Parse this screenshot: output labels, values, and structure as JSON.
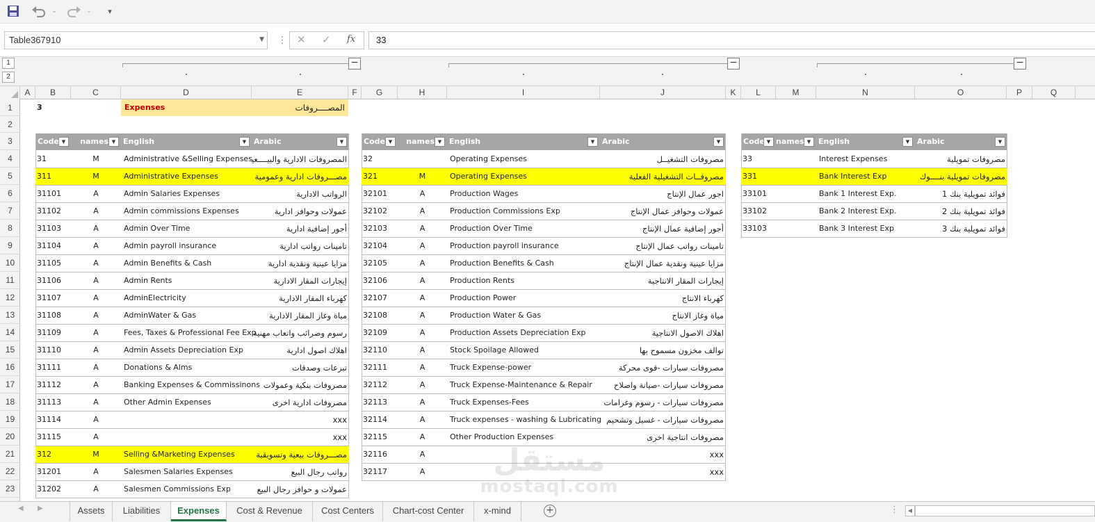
{
  "toolbar": {
    "save_icon": "save-icon",
    "undo_icon": "undo-icon",
    "redo_icon": "redo-icon",
    "customize_icon": "customize-icon"
  },
  "formula_bar": {
    "name_box": "Table367910",
    "cancel": "✕",
    "enter": "✓",
    "fx": "fx",
    "formula": "33"
  },
  "outline_levels": [
    "1",
    "2"
  ],
  "columns": [
    "A",
    "B",
    "C",
    "D",
    "E",
    "F",
    "G",
    "H",
    "I",
    "J",
    "K",
    "L",
    "M",
    "N",
    "O",
    "P",
    "Q"
  ],
  "rows": [
    "1",
    "2",
    "3",
    "4",
    "5",
    "6",
    "7",
    "8",
    "9",
    "10",
    "11",
    "12",
    "13",
    "14",
    "15",
    "16",
    "17",
    "18",
    "19",
    "20",
    "21",
    "22",
    "23"
  ],
  "row1": {
    "b": "3",
    "d": "Expenses",
    "e": "المصــــروفات"
  },
  "table1": {
    "headers": [
      "Code",
      "names",
      "English",
      "Arabic"
    ],
    "rows": [
      [
        "31",
        "M",
        "Administrative &Selling Expenses",
        "المصروفات الادارية والبيــــعية"
      ],
      [
        "311",
        "M",
        "Administrative Expenses",
        "مصـــروفات ادارية وعمومية"
      ],
      [
        "31101",
        "A",
        "Admin Salaries Expenses",
        "الرواتب الادارية"
      ],
      [
        "31102",
        "A",
        "Admin commissions Expenses",
        "عمولات وحوافز ادارية"
      ],
      [
        "31103",
        "A",
        "Admin Over Time",
        "أجور إضافية ادارية"
      ],
      [
        "31104",
        "A",
        "Admin payroll insurance",
        "تامينات رواتب ادارية"
      ],
      [
        "31105",
        "A",
        "Admin Benefits & Cash",
        "مزايا عينية ونقدية ادارية"
      ],
      [
        "31106",
        "A",
        "Admin Rents",
        "إيجارات المقار الادارية"
      ],
      [
        "31107",
        "A",
        "AdminElectricity",
        "كهرباء المقار الادارية"
      ],
      [
        "31108",
        "A",
        "AdminWater & Gas",
        "مياة وغاز المقار الادارية"
      ],
      [
        "31109",
        "A",
        "Fees, Taxes & Professional Fee Exp",
        "رسوم وضرائب واتعاب مهنية"
      ],
      [
        "31110",
        "A",
        "Admin Assets Depreciation Exp",
        "اهلاك اصول ادارية"
      ],
      [
        "31111",
        "A",
        "Donations & Alms",
        "تبرعات وصدقات"
      ],
      [
        "31112",
        "A",
        "Banking Expenses & Commissinons",
        "مصروفات بنكية وعمولات"
      ],
      [
        "31113",
        "A",
        "Other Admin Expenses",
        "مصروفات ادارية اخرى"
      ],
      [
        "31114",
        "A",
        "",
        "xxx"
      ],
      [
        "31115",
        "A",
        "",
        "xxx"
      ],
      [
        "312",
        "M",
        "Selling &Marketing Expenses",
        "مصـــروفات بيعية وتسويقية"
      ],
      [
        "31201",
        "A",
        "Salesmen Salaries Expenses",
        "رواتب رجال البيع"
      ],
      [
        "31202",
        "A",
        "Salesmen Commissions  Exp",
        "عمولات و حوافز رجال البيع"
      ]
    ],
    "highlight": [
      0,
      1,
      17
    ]
  },
  "table2": {
    "headers": [
      "Code",
      "names",
      "English",
      "Arabic"
    ],
    "rows": [
      [
        "32",
        "",
        "Operating Expenses",
        "مصروفات التشغيــل"
      ],
      [
        "321",
        "M",
        "Operating Expenses",
        "مصروفــات التشغيلية الفعلية"
      ],
      [
        "32101",
        "A",
        "Production Wages",
        "اجور عمال الإنتاج"
      ],
      [
        "32102",
        "A",
        "Production Commissions Exp",
        "عمولات وحوافز عمال الإنتاج"
      ],
      [
        "32103",
        "A",
        "Production Over Time",
        "أجور إضافية عمال الإنتاج"
      ],
      [
        "32104",
        "A",
        "Production payroll insurance",
        "تامينات رواتب عمال الإنتاج"
      ],
      [
        "32105",
        "A",
        "Production Benefits & Cash",
        "مزايا عينية ونقدية عمال الإنتاج"
      ],
      [
        "32106",
        "A",
        "Production Rents",
        "إيجارات المقار الانتاجية"
      ],
      [
        "32107",
        "A",
        "Production Power",
        "كهرباء الانتاج"
      ],
      [
        "32108",
        "A",
        "Production Water & Gas",
        "مياة وغاز الانتاج"
      ],
      [
        "32109",
        "A",
        "Production Assets Depreciation Exp",
        "اهلاك الاصول الانتاجية"
      ],
      [
        "32110",
        "A",
        "Stock Spoilage Allowed",
        "توالف مخزون مسموح بها"
      ],
      [
        "32111",
        "A",
        "Truck Expense-power",
        "مصروفات سيارات -قوى محركة"
      ],
      [
        "32112",
        "A",
        "Truck Expense-Maintenance & Repair",
        "مصروفات سيارات -صيانة واصلاح"
      ],
      [
        "32113",
        "A",
        "Truck Expenses-Fees",
        "مصروفات سيارات - رسوم وغرامات"
      ],
      [
        "32114",
        "A",
        "Truck  expenses - washing & Lubricating",
        "مصروفات سيارات - غسيل وتشحيم"
      ],
      [
        "32115",
        "A",
        "Other Production  Expenses",
        "مصروفات انتاجية اخرى"
      ],
      [
        "32116",
        "A",
        "",
        "xxx"
      ],
      [
        "32117",
        "A",
        "",
        "xxx"
      ]
    ],
    "highlight": [
      1
    ]
  },
  "table3": {
    "headers": [
      "Code",
      "names",
      "English",
      "Arabic"
    ],
    "rows": [
      [
        "33",
        "",
        "Interest Expenses",
        "مصروفات تمويلية"
      ],
      [
        "331",
        "",
        "Bank Interest Exp",
        "مصروفات تمويلية بنــــوك"
      ],
      [
        "33101",
        "",
        "Bank 1 Interest Exp.",
        "فوائد تمويلية بنك 1"
      ],
      [
        "33102",
        "",
        "Bank 2 Interest Exp.",
        "فوائد تمويلية بنك 2"
      ],
      [
        "33103",
        "",
        "Bank 3 Interest Exp",
        "فوائد تمويلية بنك 3"
      ]
    ],
    "highlight": [
      1
    ]
  },
  "sheet_tabs": [
    "Assets",
    "Liabilities",
    "Expenses",
    "Cost & Revenue",
    "Cost Centers",
    "Chart-cost Center",
    "x-mind"
  ],
  "active_tab": "Expenses",
  "watermark": {
    "arabic": "مستقل",
    "latin": "mostaql.com"
  },
  "colors": {
    "header_gray": "#a6a6a6",
    "highlight_yellow": "#ffff00",
    "title_fill": "#ffe699",
    "title_text": "#c00000",
    "accent_green": "#217346"
  }
}
